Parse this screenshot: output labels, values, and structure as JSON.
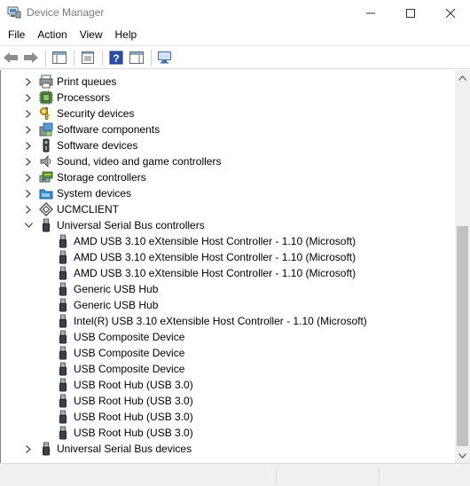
{
  "window": {
    "title": "Device Manager"
  },
  "window_controls": {
    "minimize": "—",
    "maximize": "☐",
    "close": "✕"
  },
  "menu": [
    "File",
    "Action",
    "View",
    "Help"
  ],
  "toolbar_icons": [
    "back-icon",
    "forward-icon",
    "show-hide-console-tree-icon",
    "properties-icon",
    "help-icon",
    "action-pane-icon",
    "scan-hardware-icon"
  ],
  "tree": {
    "items": [
      {
        "label": "Print queues",
        "level": 1,
        "expanded": false,
        "icon": "printer-icon"
      },
      {
        "label": "Processors",
        "level": 1,
        "expanded": false,
        "icon": "processor-icon"
      },
      {
        "label": "Security devices",
        "level": 1,
        "expanded": false,
        "icon": "key-icon"
      },
      {
        "label": "Software components",
        "level": 1,
        "expanded": false,
        "icon": "puzzle-icon"
      },
      {
        "label": "Software devices",
        "level": 1,
        "expanded": false,
        "icon": "device-icon"
      },
      {
        "label": "Sound, video and game controllers",
        "level": 1,
        "expanded": false,
        "icon": "speaker-icon"
      },
      {
        "label": "Storage controllers",
        "level": 1,
        "expanded": false,
        "icon": "storage-icon"
      },
      {
        "label": "System devices",
        "level": 1,
        "expanded": false,
        "icon": "system-folder-icon"
      },
      {
        "label": "UCMCLIENT",
        "level": 1,
        "expanded": false,
        "icon": "ucm-icon"
      },
      {
        "label": "Universal Serial Bus controllers",
        "level": 1,
        "expanded": true,
        "icon": "usb-icon"
      },
      {
        "label": "AMD USB 3.10 eXtensible Host Controller - 1.10 (Microsoft)",
        "level": 2,
        "icon": "usb-icon"
      },
      {
        "label": "AMD USB 3.10 eXtensible Host Controller - 1.10 (Microsoft)",
        "level": 2,
        "icon": "usb-icon"
      },
      {
        "label": "AMD USB 3.10 eXtensible Host Controller - 1.10 (Microsoft)",
        "level": 2,
        "icon": "usb-icon"
      },
      {
        "label": "Generic USB Hub",
        "level": 2,
        "icon": "usb-icon"
      },
      {
        "label": "Generic USB Hub",
        "level": 2,
        "icon": "usb-icon"
      },
      {
        "label": "Intel(R) USB 3.10 eXtensible Host Controller - 1.10 (Microsoft)",
        "level": 2,
        "icon": "usb-icon"
      },
      {
        "label": "USB Composite Device",
        "level": 2,
        "icon": "usb-icon"
      },
      {
        "label": "USB Composite Device",
        "level": 2,
        "icon": "usb-icon"
      },
      {
        "label": "USB Composite Device",
        "level": 2,
        "icon": "usb-icon"
      },
      {
        "label": "USB Root Hub (USB 3.0)",
        "level": 2,
        "icon": "usb-icon"
      },
      {
        "label": "USB Root Hub (USB 3.0)",
        "level": 2,
        "icon": "usb-icon"
      },
      {
        "label": "USB Root Hub (USB 3.0)",
        "level": 2,
        "icon": "usb-icon"
      },
      {
        "label": "USB Root Hub (USB 3.0)",
        "level": 2,
        "icon": "usb-icon"
      },
      {
        "label": "Universal Serial Bus devices",
        "level": 1,
        "expanded": false,
        "icon": "usb-icon"
      }
    ]
  }
}
